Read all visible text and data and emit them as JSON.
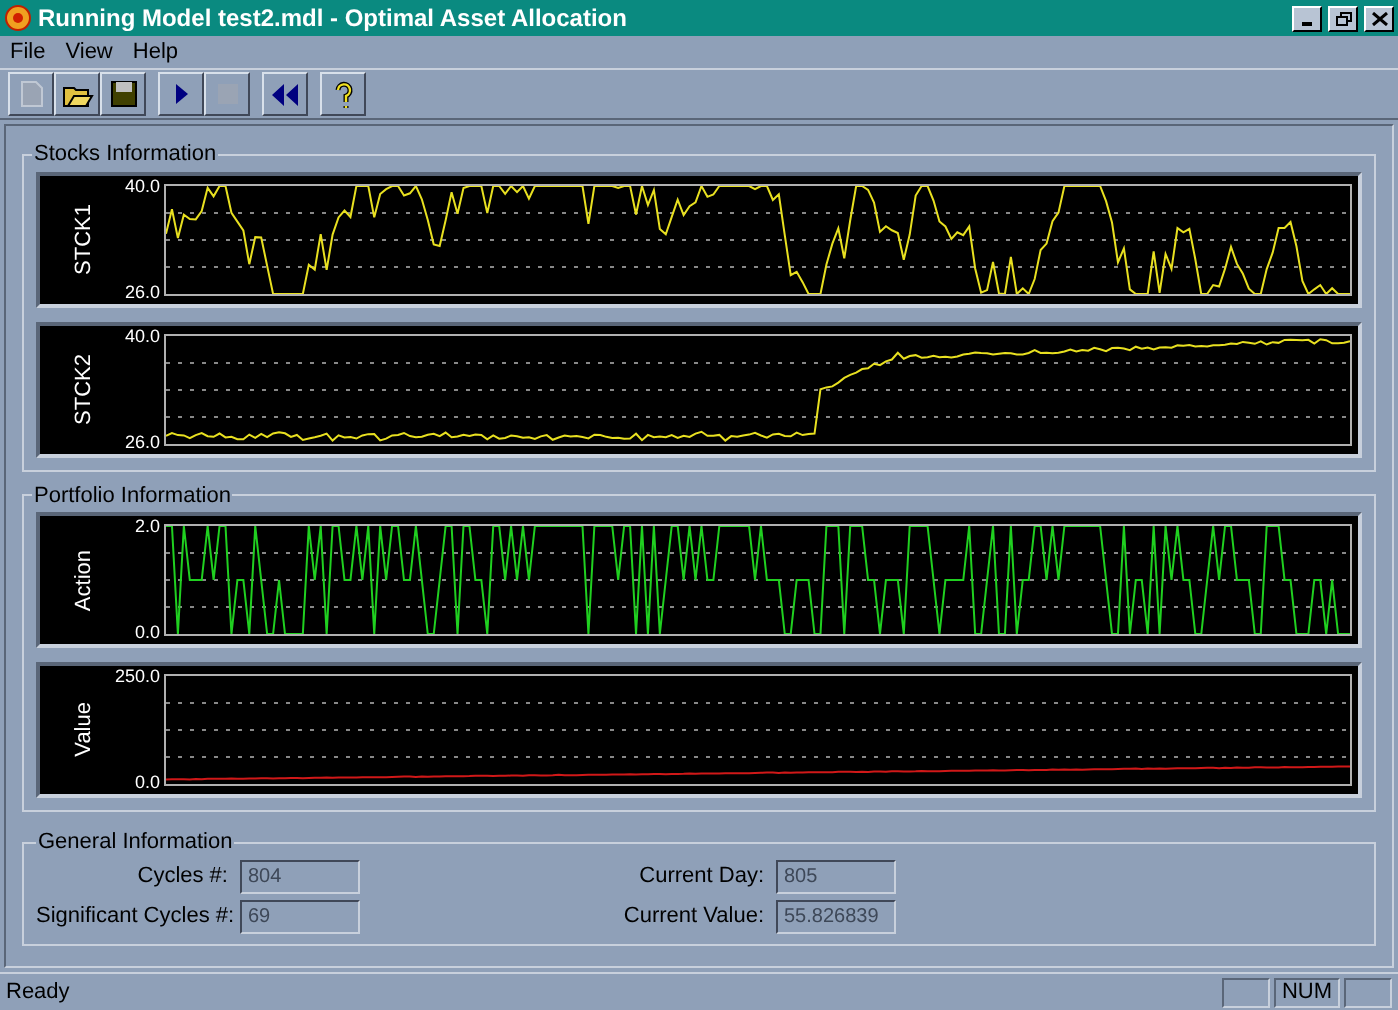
{
  "window": {
    "title": "Running Model test2.mdl - Optimal Asset Allocation"
  },
  "menu": [
    "File",
    "View",
    "Help"
  ],
  "toolbar": [
    {
      "kind": "new",
      "disabled": true
    },
    {
      "kind": "open",
      "disabled": false
    },
    {
      "kind": "save",
      "disabled": false
    },
    {
      "kind": "play",
      "disabled": false
    },
    {
      "kind": "stop",
      "disabled": true
    },
    {
      "kind": "rewind",
      "disabled": false
    },
    {
      "kind": "help",
      "disabled": false
    }
  ],
  "groups": [
    {
      "title": "Stocks Information",
      "charts": [
        {
          "label": "STCK1",
          "ymax": "40.0",
          "ymin": "26.0",
          "color": "#e8e020",
          "kind": "jumpy"
        },
        {
          "label": "STCK2",
          "ymax": "40.0",
          "ymin": "26.0",
          "color": "#e8e020",
          "kind": "rising"
        }
      ]
    },
    {
      "title": "Portfolio Information",
      "charts": [
        {
          "label": "Action",
          "ymax": "2.0",
          "ymin": "0.0",
          "color": "#20d020",
          "kind": "steps"
        },
        {
          "label": "Value",
          "ymax": "250.0",
          "ymin": "0.0",
          "color": "#d01818",
          "kind": "low"
        }
      ]
    }
  ],
  "general": {
    "title": "General Information",
    "fields": [
      {
        "label": "Cycles #:",
        "value": "804"
      },
      {
        "label": "Current Day:",
        "value": "805"
      },
      {
        "label": "Significant Cycles #:",
        "value": "69"
      },
      {
        "label": "Current Value:",
        "value": "55.826839"
      }
    ]
  },
  "status_bar": {
    "text": "Ready",
    "indicator": "NUM"
  }
}
